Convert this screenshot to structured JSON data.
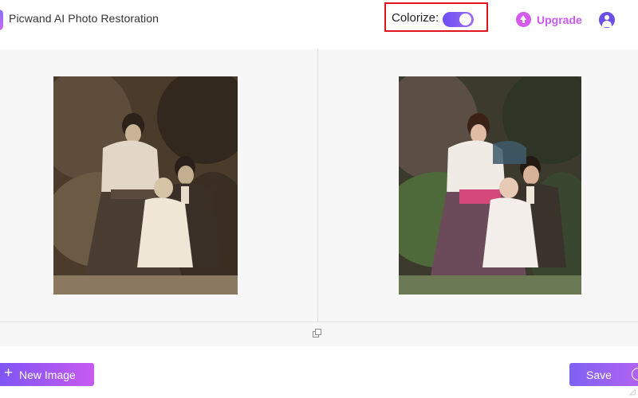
{
  "header": {
    "app_title": "Picwand AI Photo Restoration",
    "colorize_label": "Colorize:",
    "colorize_on": true,
    "upgrade_label": "Upgrade",
    "upgrade_icon": "upload-arrow-icon",
    "account_icon": "user-icon"
  },
  "workspace": {
    "original_photo": "photo-original",
    "result_photo": "photo-colorized",
    "compare_icon": "compare-icon"
  },
  "footer": {
    "new_image_label": "New Image",
    "save_label": "Save"
  },
  "colors": {
    "accent": "#7d55f5",
    "accent_pink": "#c95af0",
    "highlight_box": "#e0141f"
  }
}
